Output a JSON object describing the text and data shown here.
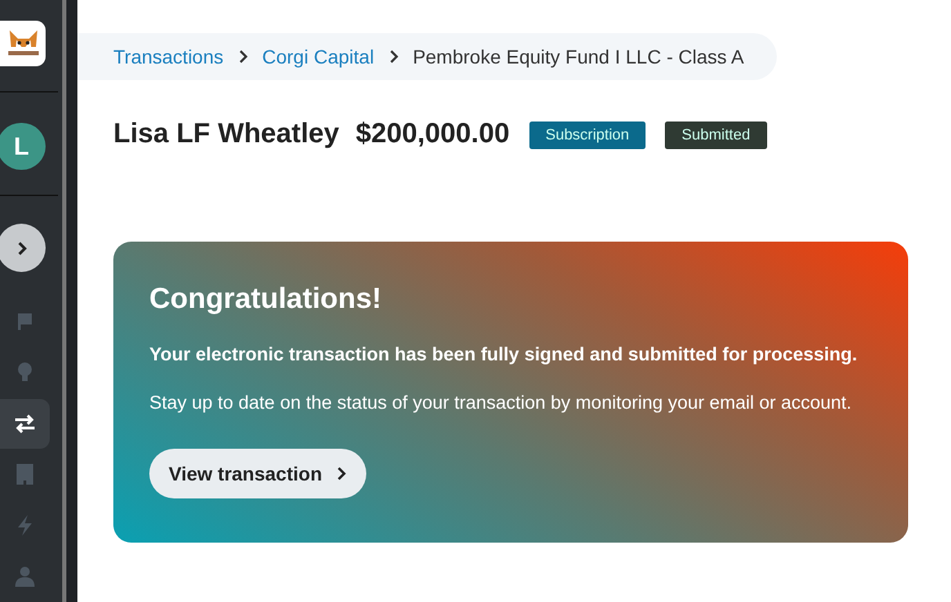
{
  "sidebar": {
    "avatar": "L",
    "nav": [
      {
        "kind": "flag",
        "selected": false
      },
      {
        "kind": "bulb",
        "selected": false
      },
      {
        "kind": "transfer",
        "selected": true
      },
      {
        "kind": "building",
        "selected": false
      },
      {
        "kind": "bolt",
        "selected": false
      },
      {
        "kind": "person",
        "selected": false
      }
    ]
  },
  "breadcrumb": [
    {
      "label": "Transactions",
      "link": true
    },
    {
      "label": "Corgi Capital",
      "link": true
    },
    {
      "label": "Pembroke Equity Fund I LLC - Class A",
      "link": false
    }
  ],
  "header": {
    "name": "Lisa LF Wheatley",
    "amount": "$200,000.00",
    "badges": [
      {
        "label": "Subscription",
        "color": "#0b6a8c"
      },
      {
        "label": "Submitted",
        "color": "#2f3a33"
      }
    ]
  },
  "card": {
    "title": "Congratulations!",
    "message": "Your electronic transaction has been fully signed and submitted for processing.",
    "note": "Stay up to date on the status of your transaction by monitoring your email or account.",
    "button": "View transaction"
  }
}
